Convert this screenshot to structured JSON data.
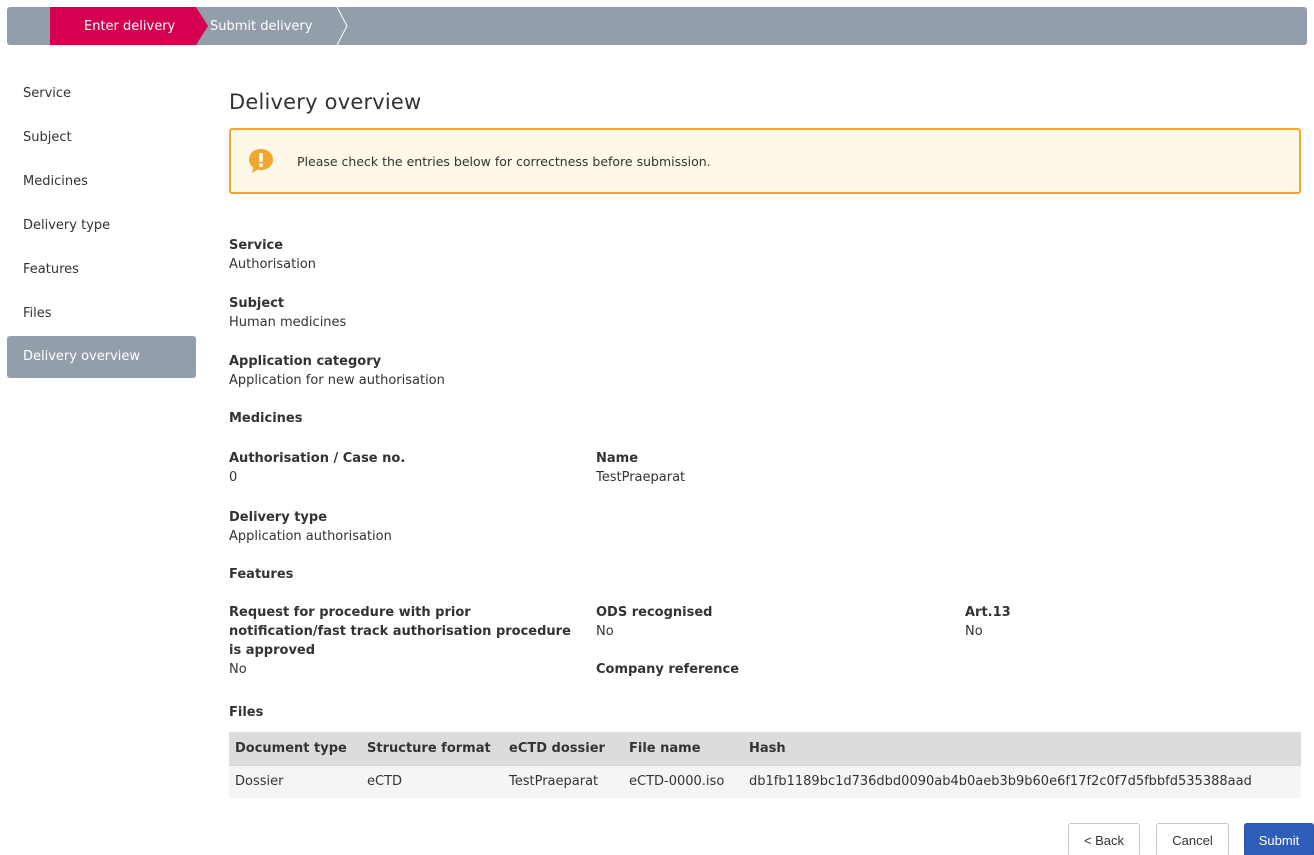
{
  "steps": {
    "enter": "Enter delivery",
    "submit": "Submit delivery"
  },
  "sidebar": {
    "items": [
      {
        "label": "Service"
      },
      {
        "label": "Subject"
      },
      {
        "label": "Medicines"
      },
      {
        "label": "Delivery type"
      },
      {
        "label": "Features"
      },
      {
        "label": "Files"
      },
      {
        "label": "Delivery overview"
      }
    ]
  },
  "main": {
    "title": "Delivery overview",
    "alert": "Please check the entries below for correctness before submission.",
    "service": {
      "label": "Service",
      "value": "Authorisation"
    },
    "subject": {
      "label": "Subject",
      "value": "Human medicines"
    },
    "application_category": {
      "label": "Application category",
      "value": "Application for new authorisation"
    },
    "medicines": {
      "heading": "Medicines",
      "case_no": {
        "label": "Authorisation / Case no.",
        "value": "0"
      },
      "name": {
        "label": "Name",
        "value": "TestPraeparat"
      }
    },
    "delivery_type": {
      "label": "Delivery type",
      "value": "Application authorisation"
    },
    "features": {
      "heading": "Features",
      "fast_track": {
        "label_line1": "Request for procedure with prior",
        "label_line2": "notification/fast track authorisation procedure",
        "label_line3": "is approved",
        "value": "No"
      },
      "ods": {
        "label": "ODS recognised",
        "value": "No"
      },
      "company_ref": {
        "label": "Company reference"
      },
      "art13": {
        "label": "Art.13",
        "value": "No"
      }
    },
    "files": {
      "heading": "Files",
      "columns": [
        "Document type",
        "Structure format",
        "eCTD dossier",
        "File name",
        "Hash"
      ],
      "rows": [
        [
          "Dossier",
          "eCTD",
          "TestPraeparat",
          "eCTD-0000.iso",
          "db1fb1189bc1d736dbd0090ab4b0aeb3b9b60e6f17f2c0f7d5fbbfd535388aad"
        ]
      ]
    }
  },
  "buttons": {
    "back": "< Back",
    "cancel": "Cancel",
    "submit": "Submit"
  },
  "colors": {
    "active_step": "#d4004f",
    "stepbar": "#939eab",
    "alert_border": "#f0a830",
    "alert_bg": "#fdf8e7",
    "primary": "#2e5eb8"
  }
}
